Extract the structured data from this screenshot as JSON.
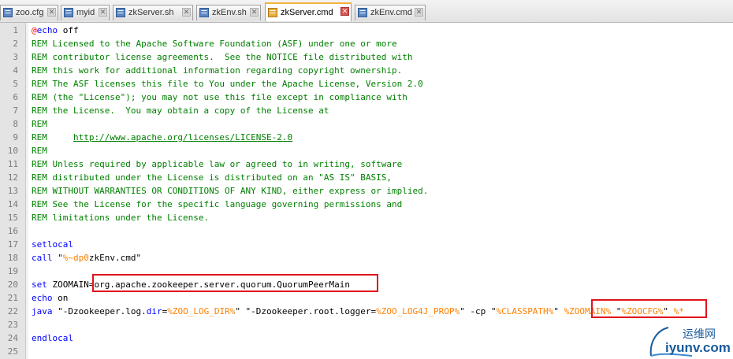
{
  "tabs": [
    {
      "label": "zoo.cfg",
      "active": false
    },
    {
      "label": "myid",
      "active": false
    },
    {
      "label": "zkServer.sh",
      "active": false
    },
    {
      "label": "zkEnv.sh",
      "active": false
    },
    {
      "label": "zkServer.cmd",
      "active": true
    },
    {
      "label": "zkEnv.cmd",
      "active": false
    }
  ],
  "editor": {
    "line_numbers": [
      "1",
      "2",
      "3",
      "4",
      "5",
      "6",
      "7",
      "8",
      "9",
      "10",
      "11",
      "12",
      "13",
      "14",
      "15",
      "16",
      "17",
      "18",
      "19",
      "20",
      "21",
      "22",
      "23",
      "24",
      "25"
    ],
    "lines": [
      [
        {
          "t": "@",
          "c": "at"
        },
        {
          "t": "echo",
          "c": "kw"
        },
        {
          "t": " off",
          "c": "str"
        }
      ],
      [
        {
          "t": "REM Licensed to the Apache Software Foundation (ASF) under one or more",
          "c": "rem"
        }
      ],
      [
        {
          "t": "REM contributor license agreements.  See the NOTICE file distributed with",
          "c": "rem"
        }
      ],
      [
        {
          "t": "REM this work for additional information regarding copyright ownership.",
          "c": "rem"
        }
      ],
      [
        {
          "t": "REM The ASF licenses this file to You under the Apache License, Version 2.0",
          "c": "rem"
        }
      ],
      [
        {
          "t": "REM (the \"License\"); you may not use this file except in compliance with",
          "c": "rem"
        }
      ],
      [
        {
          "t": "REM the License.  You may obtain a copy of the License at",
          "c": "rem"
        }
      ],
      [
        {
          "t": "REM",
          "c": "rem"
        }
      ],
      [
        {
          "t": "REM     ",
          "c": "rem"
        },
        {
          "t": "http://www.apache.org/licenses/LICENSE-2.0",
          "c": "url"
        }
      ],
      [
        {
          "t": "REM",
          "c": "rem"
        }
      ],
      [
        {
          "t": "REM Unless required by applicable law or agreed to in writing, software",
          "c": "rem"
        }
      ],
      [
        {
          "t": "REM distributed under the License is distributed on an \"AS IS\" BASIS,",
          "c": "rem"
        }
      ],
      [
        {
          "t": "REM WITHOUT WARRANTIES OR CONDITIONS OF ANY KIND, either express or implied.",
          "c": "rem"
        }
      ],
      [
        {
          "t": "REM See the License for the specific language governing permissions and",
          "c": "rem"
        }
      ],
      [
        {
          "t": "REM limitations under the License.",
          "c": "rem"
        }
      ],
      [],
      [
        {
          "t": "setlocal",
          "c": "kw"
        }
      ],
      [
        {
          "t": "call",
          "c": "kw"
        },
        {
          "t": " \"",
          "c": "str"
        },
        {
          "t": "%~dp0",
          "c": "var"
        },
        {
          "t": "zkEnv.cmd\"",
          "c": "str"
        }
      ],
      [],
      [
        {
          "t": "set",
          "c": "kw"
        },
        {
          "t": " ZOOMAIN=org.apache.zookeeper.server.quorum.QuorumPeerMain",
          "c": "str"
        }
      ],
      [
        {
          "t": "echo",
          "c": "kw"
        },
        {
          "t": " on",
          "c": "str"
        }
      ],
      [
        {
          "t": "java",
          "c": "kw"
        },
        {
          "t": " \"-Dzookeeper.log.",
          "c": "str"
        },
        {
          "t": "dir",
          "c": "kw"
        },
        {
          "t": "=",
          "c": "str"
        },
        {
          "t": "%ZOO_LOG_DIR%",
          "c": "var"
        },
        {
          "t": "\" \"-Dzookeeper.root.logger=",
          "c": "str"
        },
        {
          "t": "%ZOO_LOG4J_PROP%",
          "c": "var"
        },
        {
          "t": "\" -cp \"",
          "c": "str"
        },
        {
          "t": "%CLASSPATH%",
          "c": "var"
        },
        {
          "t": "\" ",
          "c": "str"
        },
        {
          "t": "%ZOOMAIN%",
          "c": "var"
        },
        {
          "t": " \"",
          "c": "str"
        },
        {
          "t": "%ZOOCFG%",
          "c": "var"
        },
        {
          "t": "\" ",
          "c": "str"
        },
        {
          "t": "%*",
          "c": "var"
        }
      ],
      [],
      [
        {
          "t": "endlocal",
          "c": "kw"
        }
      ],
      []
    ]
  },
  "watermark": {
    "cn": "运维网",
    "en": "iyunv.com"
  },
  "colors": {
    "comment": "#008000",
    "keyword": "#0000ff",
    "variable": "#ff8000",
    "at_sign": "#ff0000",
    "highlight_box": "#e0141e",
    "active_tab_accent": "#f5b23d"
  }
}
